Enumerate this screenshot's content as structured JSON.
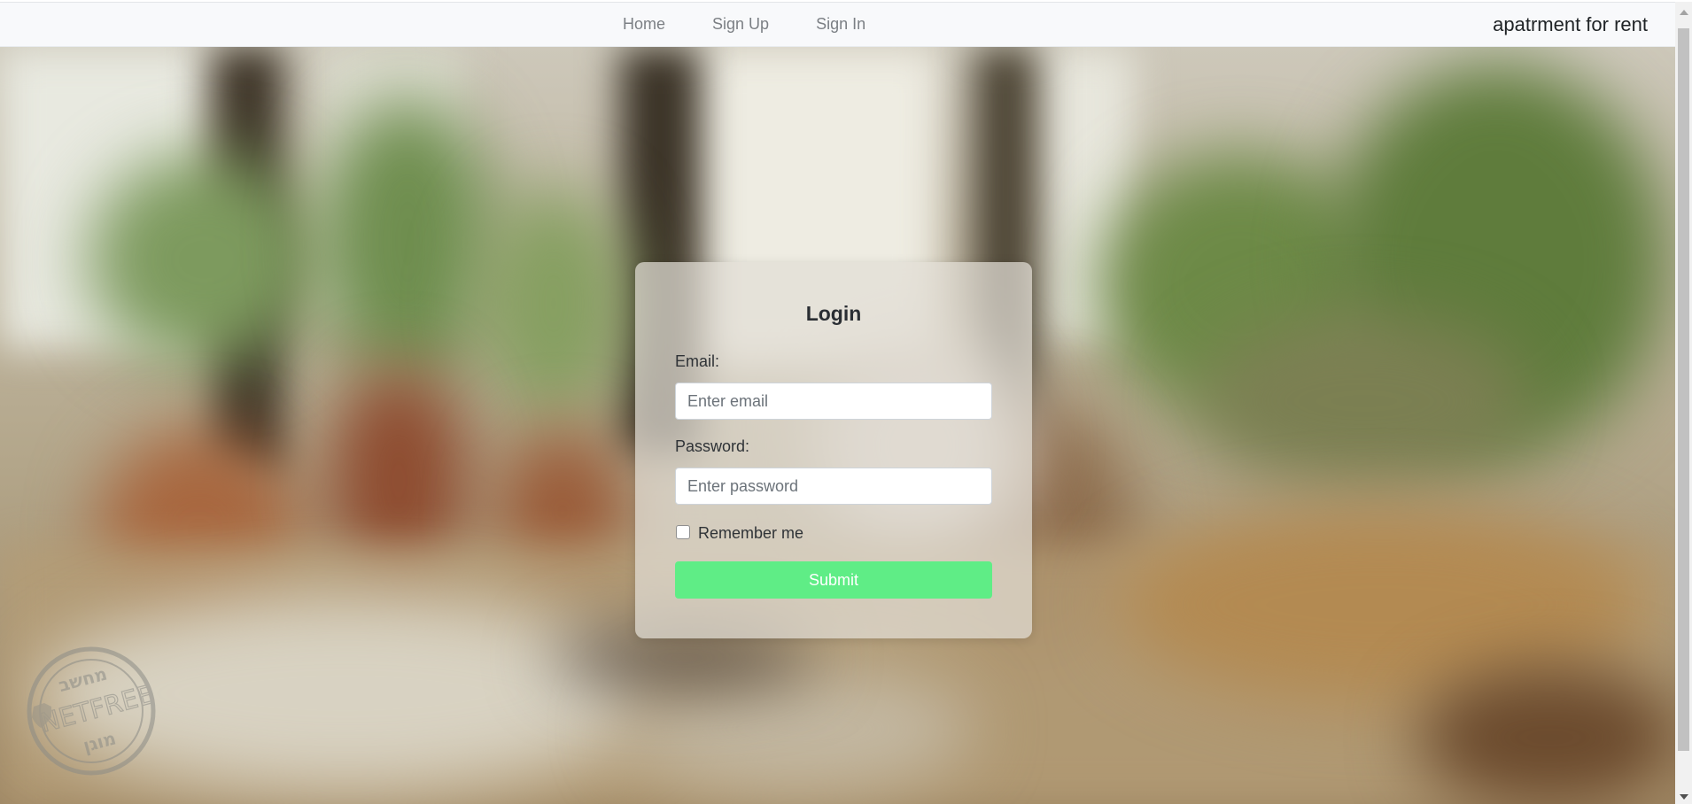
{
  "nav": {
    "links": [
      "Home",
      "Sign Up",
      "Sign In"
    ],
    "brand": "apatrment for rent"
  },
  "login": {
    "title": "Login",
    "email_label": "Email:",
    "email_placeholder": "Enter email",
    "email_value": "",
    "password_label": "Password:",
    "password_placeholder": "Enter password",
    "password_value": "",
    "remember_label": "Remember me",
    "remember_checked": false,
    "submit_label": "Submit"
  },
  "watermark": {
    "top_text": "מחשב",
    "middle_text": "NETFREE",
    "bottom_text": "מוגן"
  },
  "colors": {
    "accent_button": "#5fed86",
    "navbar_bg": "#f8f9fb",
    "nav_link": "#7b7f84",
    "brand_text": "#1f2326"
  },
  "icons": {
    "scroll_up": "triangle-up",
    "scroll_down": "triangle-down",
    "checkbox": "empty-square",
    "stamp": "shield-badge"
  }
}
